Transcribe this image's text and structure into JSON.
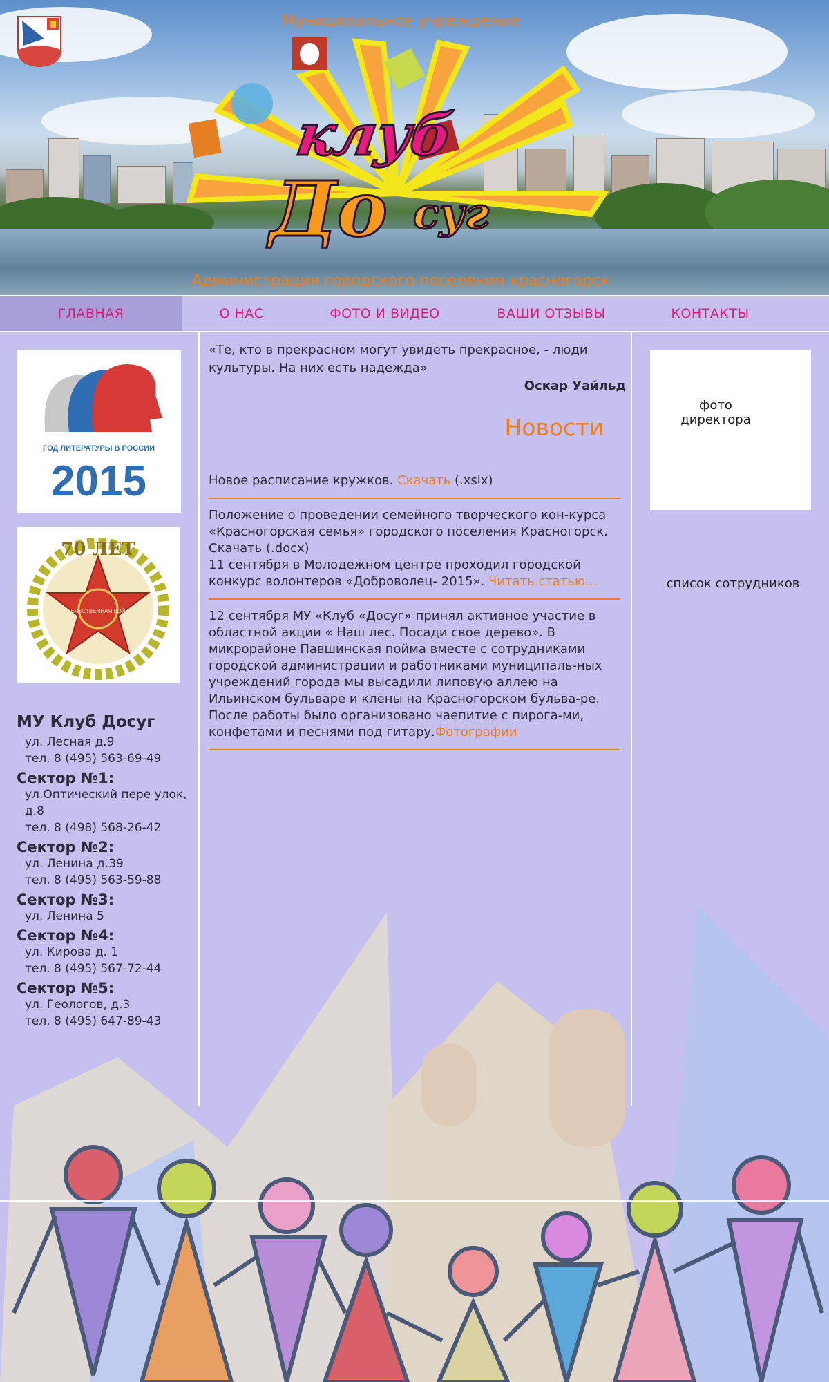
{
  "header": {
    "org_title": "Муниципальное учреждение",
    "admin_title": "Администрация городского поселения красногорск",
    "logo": {
      "line1": "клуб",
      "line2": "До",
      "line3": "суг"
    }
  },
  "nav": {
    "items": [
      {
        "label": "ГЛАВНАЯ"
      },
      {
        "label": "О НАС"
      },
      {
        "label": "ФОТО И ВИДЕО"
      },
      {
        "label": "ВАШИ ОТЗЫВЫ"
      },
      {
        "label": "КОНТАКТЫ"
      }
    ]
  },
  "sidebar": {
    "banner1": {
      "caption": "ГОД ЛИТЕРАТУРЫ В РОССИИ",
      "year": "2015"
    },
    "banner2": {
      "title": "70 ЛЕТ",
      "ring": "ОТЕЧЕСТВЕННАЯ ВОЙНА"
    },
    "contacts": {
      "org": "МУ Клуб Досуг",
      "org_address": "ул. Лесная д.9",
      "org_phone": "тел. 8 (495) 563-69-49",
      "sectors": [
        {
          "name": "Сектор №1:",
          "address": "ул.Оптический пере улок, д.8",
          "phone": "тел. 8 (498) 568-26-42"
        },
        {
          "name": "Сектор №2:",
          "address": "ул. Ленина д.39",
          "phone": "тел. 8 (495) 563-59-88"
        },
        {
          "name": "Сектор №3:",
          "address": "ул. Ленина 5",
          "phone": ""
        },
        {
          "name": "Сектор №4:",
          "address": "ул. Кирова д. 1",
          "phone": "тел. 8 (495) 567-72-44"
        },
        {
          "name": "Сектор №5:",
          "address": "ул. Геологов, д.3",
          "phone": "тел. 8 (495) 647-89-43"
        }
      ]
    }
  },
  "main": {
    "quote": "«Те, кто в прекрасном могут увидеть прекрасное, - люди культуры. На них есть надежда»",
    "quote_author": "Оскар Уайльд",
    "news_title": "Новости",
    "news": [
      {
        "text": "Новое расписание кружков. ",
        "link": "Скачать",
        "after": " (.xslx)"
      },
      {
        "text": "Положение о проведении семейного творческого кон-курса «Красногорская семья» городского поселения Красногорск. Скачать (.docx)",
        "text2": "11 сентября в Молодежном центре проходил городской конкурс волонтеров «Доброволец- 2015». ",
        "link": "Читать статью...",
        "after": ""
      },
      {
        "text": "12 сентября МУ «Клуб «Досуг» принял активное участие в областной акции « Наш лес. Посади свое дерево». В микрорайоне Павшинская пойма вместе с сотрудниками городской администрации и работниками муниципаль-ных учреждений города мы высадили липовую аллею на Ильинском бульваре и клены на Красногорском бульва-ре. После работы было организовано чаепитие с пирога-ми, конфетами и песнями под гитару.",
        "link": "Фотографии",
        "after": ""
      }
    ]
  },
  "right": {
    "director_photo": "фото директора",
    "staff_link": "список сотрудников"
  },
  "colors": {
    "accent": "#f07d17",
    "nav_text": "#e4197c",
    "background": "#c6c0ef",
    "nav_active": "#a89ed9"
  }
}
